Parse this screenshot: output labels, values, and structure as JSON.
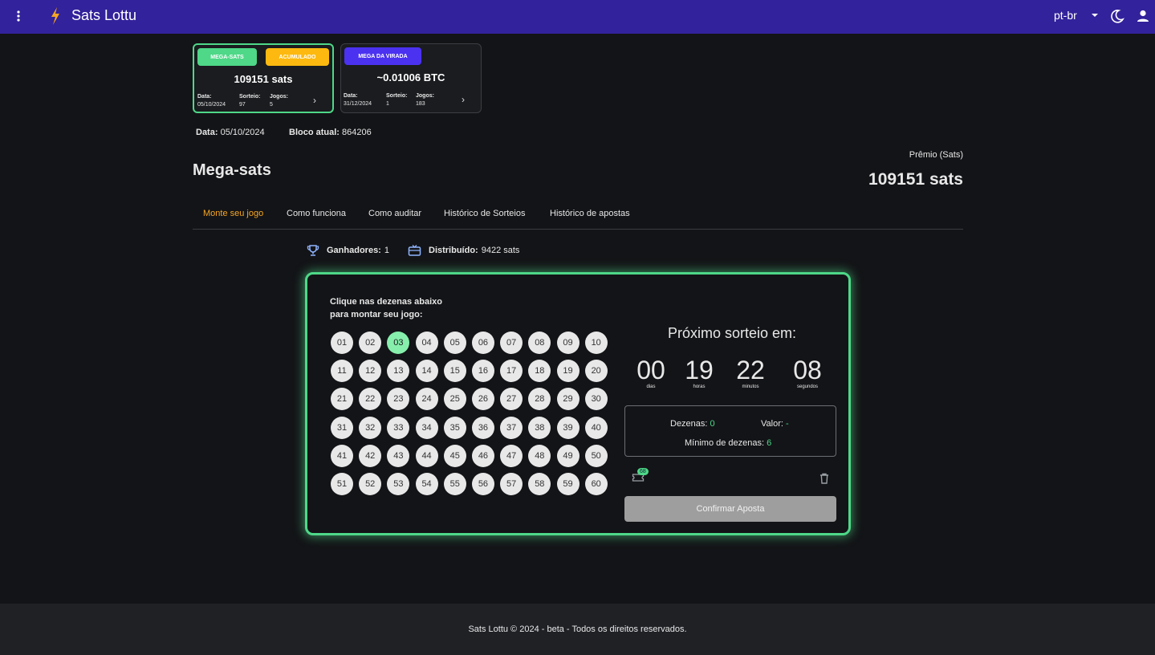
{
  "header": {
    "app_title": "Sats Lottu",
    "language": "pt-br",
    "icons": [
      "more-vert-icon",
      "lightning-bolt-icon",
      "chevron-down-icon",
      "moon-icon",
      "user-icon"
    ]
  },
  "cards": [
    {
      "pill_primary": "MEGA-SATS",
      "pill_secondary": "ACUMULADO",
      "amount": "109151 sats",
      "date_label": "Data:",
      "date_value": "05/10/2024",
      "draw_label": "Sorteio:",
      "draw_value": "97",
      "games_label": "Jogos:",
      "games_value": "5",
      "arrow": "›"
    },
    {
      "pill_primary": "MEGA DA VIRADA",
      "amount": "~0.01006 BTC",
      "date_label": "Data:",
      "date_value": "31/12/2024",
      "draw_label": "Sorteio:",
      "draw_value": "1",
      "games_label": "Jogos:",
      "games_value": "183",
      "arrow": "›"
    }
  ],
  "info": {
    "date_label": "Data:",
    "date_value": "05/10/2024",
    "block_label": "Bloco atual:",
    "block_value": "864206"
  },
  "page": {
    "title": "Mega-sats",
    "prize_label": "Prêmio (Sats)",
    "prize_value": "109151 sats"
  },
  "tabs": [
    "Monte seu jogo",
    "Como funciona",
    "Como auditar",
    "Histórico de Sorteios",
    "Histórico de apostas"
  ],
  "stats": {
    "winners_label": "Ganhadores:",
    "winners_value": "1",
    "distributed_label": "Distribuído:",
    "distributed_value": "9422 sats"
  },
  "game": {
    "instruction_line1": "Clique nas dezenas abaixo",
    "instruction_line2": "para montar seu jogo:",
    "numbers": [
      "01",
      "02",
      "03",
      "04",
      "05",
      "06",
      "07",
      "08",
      "09",
      "10",
      "11",
      "12",
      "13",
      "14",
      "15",
      "16",
      "17",
      "18",
      "19",
      "20",
      "21",
      "22",
      "23",
      "24",
      "25",
      "26",
      "27",
      "28",
      "29",
      "30",
      "31",
      "32",
      "33",
      "34",
      "35",
      "36",
      "37",
      "38",
      "39",
      "40",
      "41",
      "42",
      "43",
      "44",
      "45",
      "46",
      "47",
      "48",
      "49",
      "50",
      "51",
      "52",
      "53",
      "54",
      "55",
      "56",
      "57",
      "58",
      "59",
      "60"
    ],
    "selected": [
      "03"
    ],
    "next_draw_label": "Próximo sorteio em:",
    "countdown": {
      "days": "00",
      "days_label": "dias",
      "hours": "19",
      "hours_label": "horas",
      "minutes": "22",
      "minutes_label": "minutos",
      "seconds": "08",
      "seconds_label": "segundos"
    },
    "summary": {
      "count_label": "Dezenas:",
      "count_value": "0",
      "price_label": "Valor:",
      "price_value": "-",
      "min_label": "Mínimo de dezenas:",
      "min_value": "6"
    },
    "ticket_badge": "68",
    "confirm_label": "Confirmar Aposta"
  },
  "footer": {
    "text": "Sats Lottu  © 2024 - beta - Todos os direitos reservados."
  },
  "colors": {
    "topbar": "#32229b",
    "accent_green": "#4ed888",
    "accent_orange": "#f5a623",
    "pill_yellow": "#fdb90f",
    "pill_purple": "#4b32f0"
  }
}
